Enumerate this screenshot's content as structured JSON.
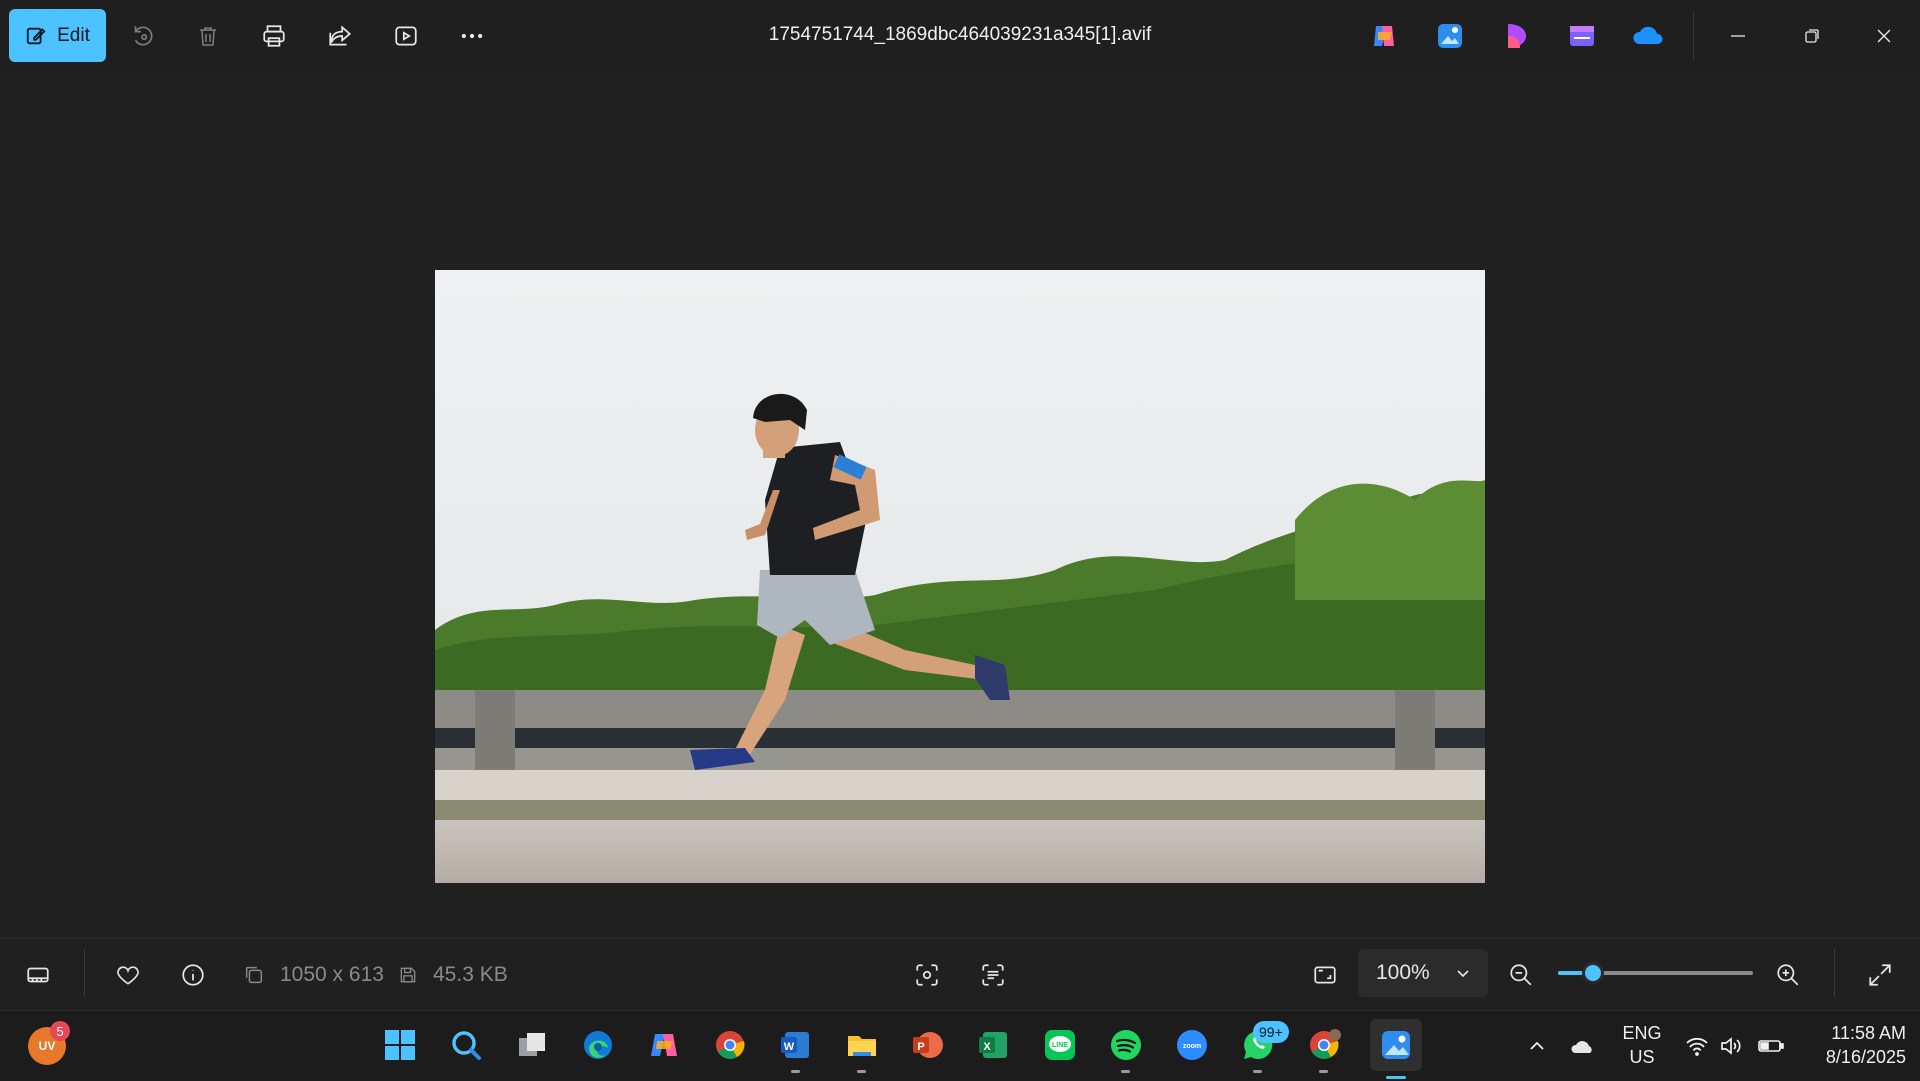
{
  "titlebar": {
    "edit_label": "Edit",
    "file_name": "1754751744_1869dbc464039231a345[1].avif",
    "actions": [
      "rotate-icon",
      "delete-icon",
      "print-icon",
      "share-icon",
      "slideshow-icon",
      "more-icon"
    ],
    "app_shortcuts": [
      "copilot",
      "photos",
      "clipchamp-like",
      "movie-maker",
      "onedrive"
    ]
  },
  "image": {
    "description_alt": "photo"
  },
  "bottombar": {
    "dimensions": "1050 x 613",
    "file_size": "45.3 KB",
    "zoom_value": "100%",
    "zoom_fraction": 0.18
  },
  "taskbar": {
    "avatar_initials": "UV",
    "avatar_badge": "5",
    "whatsapp_badge": "99+",
    "language_top": "ENG",
    "language_bottom": "US",
    "time": "11:58 AM",
    "date": "8/16/2025"
  },
  "colors": {
    "accent": "#4cc2ff",
    "background": "#202020"
  }
}
